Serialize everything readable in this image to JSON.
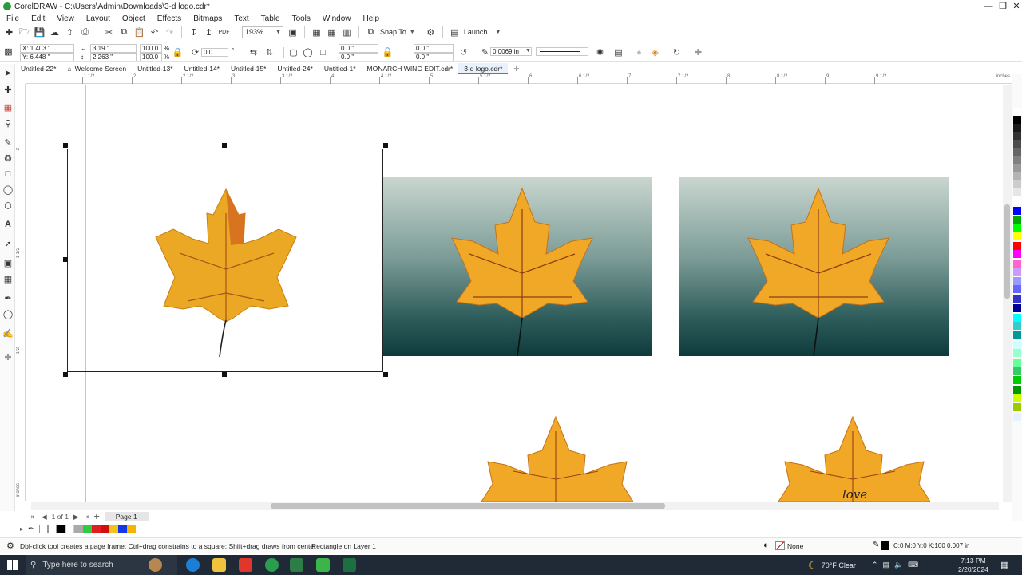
{
  "window": {
    "title": "CorelDRAW - C:\\Users\\Admin\\Downloads\\3-d logo.cdr*",
    "controls": [
      "minimize",
      "maximize",
      "close"
    ]
  },
  "menu": [
    "File",
    "Edit",
    "View",
    "Layout",
    "Object",
    "Effects",
    "Bitmaps",
    "Text",
    "Table",
    "Tools",
    "Window",
    "Help"
  ],
  "toolbar": {
    "zoom": "193%",
    "snap_label": "Snap To",
    "launch_label": "Launch"
  },
  "propbar": {
    "x": "X: 1.403 \"",
    "y": "Y: 6.448 \"",
    "w": "3.19 \"",
    "h": "2.263 \"",
    "scale_w": "100.0",
    "scale_h": "100.0",
    "pct": "%",
    "rotation": "0.0",
    "corner_a1": "0.0 \"",
    "corner_a2": "0.0 \"",
    "corner_b1": "0.0 \"",
    "corner_b2": "0.0 \"",
    "outline_width": "0.0069 in"
  },
  "tabs": [
    "Untitled-22*",
    "Welcome Screen",
    "Untitled-13*",
    "Untitled-14*",
    "Untitled-15*",
    "Untitled-24*",
    "Untitled-1*",
    "MONARCH WING EDIT.cdr*",
    "3-d logo.cdr*"
  ],
  "active_tab": "3-d logo.cdr*",
  "ruler": {
    "marks": [
      "1 1/2",
      "2",
      "2 1/2",
      "3",
      "3 1/2",
      "4",
      "4 1/2",
      "5",
      "5 1/2",
      "6",
      "6 1/2",
      "7",
      "7 1/2",
      "8",
      "8 1/2",
      "9",
      "9 1/2"
    ],
    "unit": "inches",
    "left_unit": "inches",
    "left_marks": [
      "2",
      "1 1/2",
      "1/2"
    ]
  },
  "pagebar": {
    "count": "1 of 1",
    "page_label": "Page 1"
  },
  "status": {
    "hint": "Dbl-click tool creates a page frame; Ctrl+drag constrains to a square; Shift+drag draws from center",
    "object": "Rectangle on Layer 1",
    "fill_label": "None",
    "outline": "C:0 M:0 Y:0 K:100  0.007 in"
  },
  "taskbar": {
    "search_placeholder": "Type here to search",
    "weather": "70°F  Clear",
    "time": "7:13 PM",
    "date": "2/20/2024"
  },
  "colors": {
    "accent": "#3b82c4",
    "leaf_orange": "#e9a21f",
    "photo_dark": "#0f3a3c"
  },
  "canvas": {
    "watermark_text": "love"
  }
}
